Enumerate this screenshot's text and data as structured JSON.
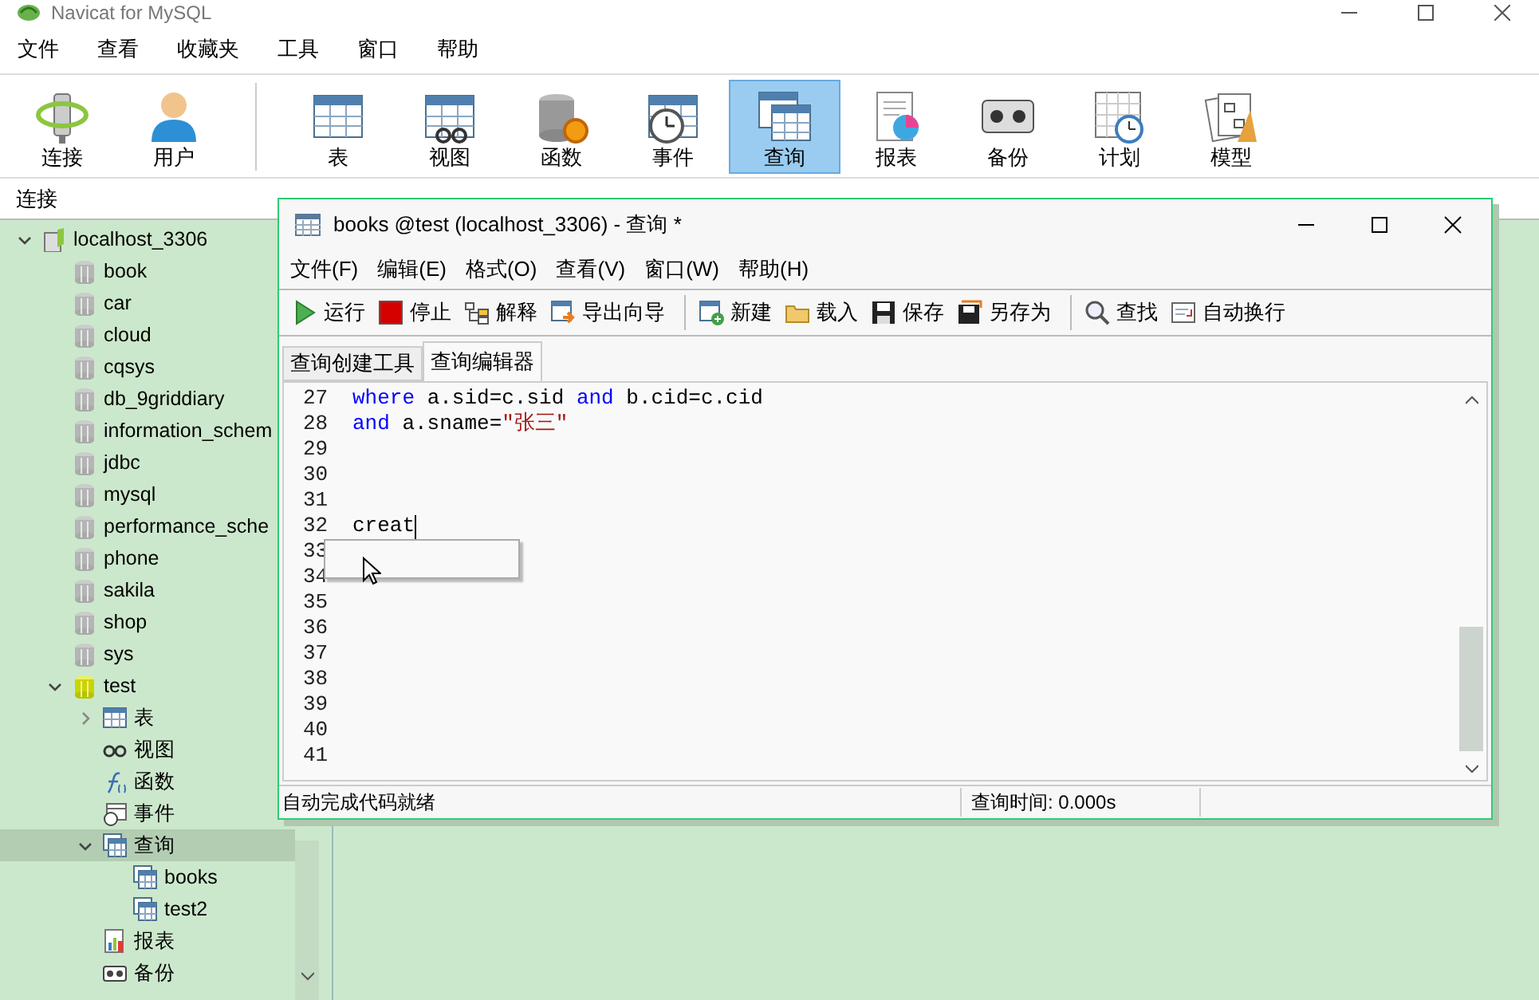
{
  "app_window": {
    "title": "Navicat for MySQL"
  },
  "menu": [
    "文件",
    "查看",
    "收藏夹",
    "工具",
    "窗口",
    "帮助"
  ],
  "toolbar": [
    {
      "label": "连接",
      "selected": false
    },
    {
      "label": "用户",
      "selected": false
    },
    {
      "label": "表",
      "selected": false
    },
    {
      "label": "视图",
      "selected": false
    },
    {
      "label": "函数",
      "selected": false
    },
    {
      "label": "事件",
      "selected": false
    },
    {
      "label": "查询",
      "selected": true
    },
    {
      "label": "报表",
      "selected": false
    },
    {
      "label": "备份",
      "selected": false
    },
    {
      "label": "计划",
      "selected": false
    },
    {
      "label": "模型",
      "selected": false
    }
  ],
  "connection_label": "连接",
  "tree": [
    {
      "label": "localhost_3306",
      "kind": "server",
      "selected": false,
      "expanded": true,
      "children": [
        {
          "label": "book",
          "kind": "database",
          "selected": false
        },
        {
          "label": "car",
          "kind": "database",
          "selected": false
        },
        {
          "label": "cloud",
          "kind": "database",
          "selected": false
        },
        {
          "label": "cqsys",
          "kind": "database",
          "selected": false
        },
        {
          "label": "db_9griddiary",
          "kind": "database",
          "selected": false
        },
        {
          "label": "information_schem",
          "kind": "database",
          "selected": false
        },
        {
          "label": "jdbc",
          "kind": "database",
          "selected": false
        },
        {
          "label": "mysql",
          "kind": "database",
          "selected": false
        },
        {
          "label": "performance_sche",
          "kind": "database",
          "selected": false
        },
        {
          "label": "phone",
          "kind": "database",
          "selected": false
        },
        {
          "label": "sakila",
          "kind": "database",
          "selected": false
        },
        {
          "label": "shop",
          "kind": "database",
          "selected": false
        },
        {
          "label": "sys",
          "kind": "database",
          "selected": false
        },
        {
          "label": "test",
          "kind": "database_open",
          "selected": false,
          "expanded": true,
          "children": [
            {
              "label": "表",
              "kind": "tables",
              "selected": false,
              "expanded": false
            },
            {
              "label": "视图",
              "kind": "views",
              "selected": false
            },
            {
              "label": "函数",
              "kind": "functions",
              "selected": false
            },
            {
              "label": "事件",
              "kind": "events",
              "selected": false
            },
            {
              "label": "查询",
              "kind": "queries",
              "selected": true,
              "expanded": true,
              "children": [
                {
                  "label": "books",
                  "kind": "query",
                  "selected": false
                },
                {
                  "label": "test2",
                  "kind": "query",
                  "selected": false
                }
              ]
            },
            {
              "label": "报表",
              "kind": "reports",
              "selected": false
            },
            {
              "label": "备份",
              "kind": "backups",
              "selected": false
            }
          ]
        }
      ]
    }
  ],
  "query_window": {
    "title": "books @test (localhost_3306) - 查询 *",
    "menu": [
      "文件(F)",
      "编辑(E)",
      "格式(O)",
      "查看(V)",
      "窗口(W)",
      "帮助(H)"
    ],
    "toolbar_groups": [
      [
        "运行",
        "停止",
        "解释",
        "导出向导"
      ],
      [
        "新建",
        "载入",
        "保存",
        "另存为"
      ],
      [
        "查找",
        "自动换行"
      ]
    ],
    "tabs": [
      {
        "label": "查询创建工具",
        "selected": false
      },
      {
        "label": "查询编辑器",
        "selected": true
      }
    ],
    "editor": {
      "lines": [
        {
          "number": "27",
          "tokens": [
            {
              "text": "where",
              "kind": "keyword"
            },
            {
              "text": " a.sid=c.sid ",
              "kind": "plain"
            },
            {
              "text": "and",
              "kind": "keyword"
            },
            {
              "text": " b.cid=c.cid",
              "kind": "plain"
            }
          ]
        },
        {
          "number": "28",
          "tokens": [
            {
              "text": "and",
              "kind": "keyword"
            },
            {
              "text": " a.sname=",
              "kind": "plain"
            },
            {
              "text": "\"张三\"",
              "kind": "string"
            }
          ]
        },
        {
          "number": "29"
        },
        {
          "number": "30"
        },
        {
          "number": "31"
        },
        {
          "number": "32",
          "tokens": [
            {
              "text": "creat",
              "kind": "plain"
            }
          ],
          "caret": true
        },
        {
          "number": "33"
        },
        {
          "number": "34"
        },
        {
          "number": "35"
        },
        {
          "number": "36"
        },
        {
          "number": "37"
        },
        {
          "number": "38"
        },
        {
          "number": "39"
        },
        {
          "number": "40"
        },
        {
          "number": "41"
        }
      ],
      "autocomplete_open": true
    },
    "status_bar": [
      "自动完成代码就绪",
      "查询时间: 0.000s"
    ]
  }
}
